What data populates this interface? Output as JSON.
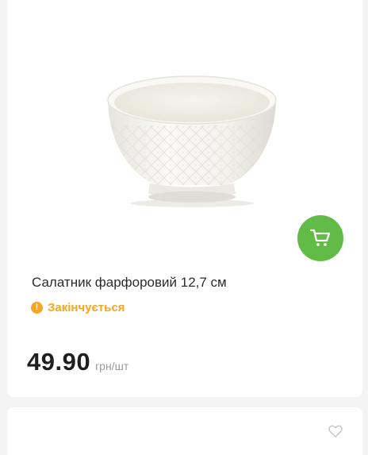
{
  "product": {
    "title": "Салатник фарфоровий 12,7 см",
    "status_text": "Закінчується",
    "status_icon": "exclamation-icon",
    "price": "49.90",
    "unit": "грн/шт",
    "image_name": "porcelain-bowl-image"
  },
  "colors": {
    "accent_green": "#62bb46",
    "status_orange": "#f5a623",
    "text_dark": "#2b2b2b",
    "muted_gray": "#9a9a9a"
  },
  "icons": {
    "cart": "shopping-cart-icon",
    "favorite": "heart-icon"
  }
}
